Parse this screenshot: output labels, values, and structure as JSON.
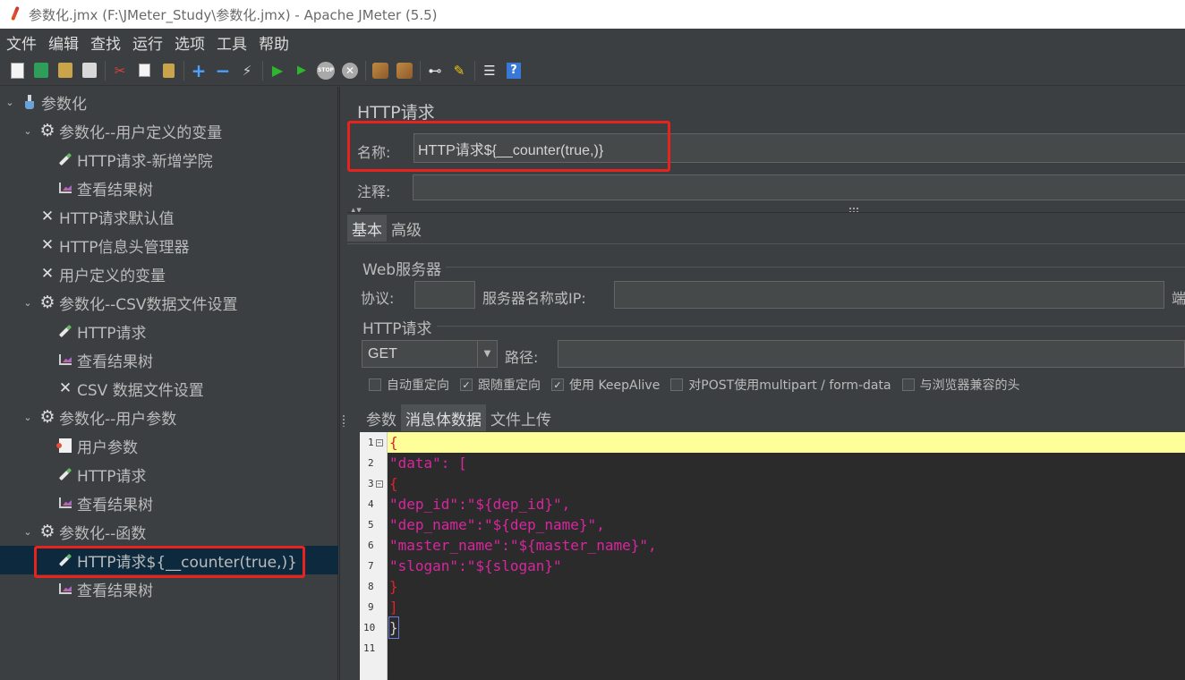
{
  "window": {
    "title": "参数化.jmx (F:\\JMeter_Study\\参数化.jmx) - Apache JMeter (5.5)"
  },
  "menubar": [
    "文件",
    "编辑",
    "查找",
    "运行",
    "选项",
    "工具",
    "帮助"
  ],
  "tree": [
    {
      "label": "参数化",
      "icon": "test-plan-icon",
      "level": 0,
      "twisty": "expanded"
    },
    {
      "label": "参数化--用户定义的变量",
      "icon": "thread-group-gear-icon",
      "level": 1,
      "twisty": "expanded"
    },
    {
      "label": "HTTP请求-新增学院",
      "icon": "sampler-pen-icon",
      "level": 2
    },
    {
      "label": "查看结果树",
      "icon": "listener-chart-icon",
      "level": 2
    },
    {
      "label": "HTTP请求默认值",
      "icon": "config-tools-icon",
      "level": 1
    },
    {
      "label": "HTTP信息头管理器",
      "icon": "config-tools-icon",
      "level": 1
    },
    {
      "label": "用户定义的变量",
      "icon": "config-tools-icon",
      "level": 1
    },
    {
      "label": "参数化--CSV数据文件设置",
      "icon": "thread-group-gear-icon",
      "level": 1,
      "twisty": "expanded"
    },
    {
      "label": "HTTP请求",
      "icon": "sampler-pen-icon",
      "level": 2
    },
    {
      "label": "查看结果树",
      "icon": "listener-chart-icon",
      "level": 2
    },
    {
      "label": "CSV 数据文件设置",
      "icon": "config-tools-icon",
      "level": 2
    },
    {
      "label": "参数化--用户参数",
      "icon": "thread-group-gear-icon",
      "level": 1,
      "twisty": "expanded"
    },
    {
      "label": "用户参数",
      "icon": "preprocessor-icon",
      "level": 2
    },
    {
      "label": "HTTP请求",
      "icon": "sampler-pen-icon",
      "level": 2
    },
    {
      "label": "查看结果树",
      "icon": "listener-chart-icon",
      "level": 2
    },
    {
      "label": "参数化--函数",
      "icon": "thread-group-gear-icon",
      "level": 1,
      "twisty": "expanded"
    },
    {
      "label": "HTTP请求${__counter(true,)}",
      "icon": "sampler-pen-icon",
      "level": 2,
      "selected": true
    },
    {
      "label": "查看结果树",
      "icon": "listener-chart-icon",
      "level": 2
    }
  ],
  "panel": {
    "title": "HTTP请求",
    "name_label": "名称:",
    "name_value": "HTTP请求${__counter(true,)}",
    "comment_label": "注释:",
    "comment_value": "",
    "tabs": [
      "基本",
      "高级"
    ],
    "web_server": {
      "group_title": "Web服务器",
      "protocol_label": "协议:",
      "protocol_value": "",
      "server_label": "服务器名称或IP:",
      "server_value": "",
      "port_label_partial": "端"
    },
    "http_request": {
      "group_title": "HTTP请求",
      "method": "GET",
      "path_label": "路径:",
      "path_value": ""
    },
    "options": [
      {
        "label": "自动重定向",
        "checked": false
      },
      {
        "label": "跟随重定向",
        "checked": true
      },
      {
        "label": "使用 KeepAlive",
        "checked": true
      },
      {
        "label": "对POST使用multipart / form-data",
        "checked": false
      },
      {
        "label": "与浏览器兼容的头",
        "checked": false
      }
    ],
    "body_tabs": [
      "参数",
      "消息体数据",
      "文件上传"
    ],
    "body_tab_active": "消息体数据",
    "body_lines": [
      "{",
      "\"data\": [",
      "{",
      "\"dep_id\":\"${dep_id}\",",
      "\"dep_name\":\"${dep_name}\",",
      "\"master_name\":\"${master_name}\",",
      "\"slogan\":\"${slogan}\"",
      "}",
      "]",
      "}",
      ""
    ],
    "line_numbers": [
      "1",
      "2",
      "3",
      "4",
      "5",
      "6",
      "7",
      "8",
      "9",
      "10",
      "11"
    ]
  },
  "colors": {
    "highlight_box": "#e8231e",
    "selected_row": "#0d293e",
    "json_string": "#d9269e",
    "json_bracket": "#e3202b"
  }
}
